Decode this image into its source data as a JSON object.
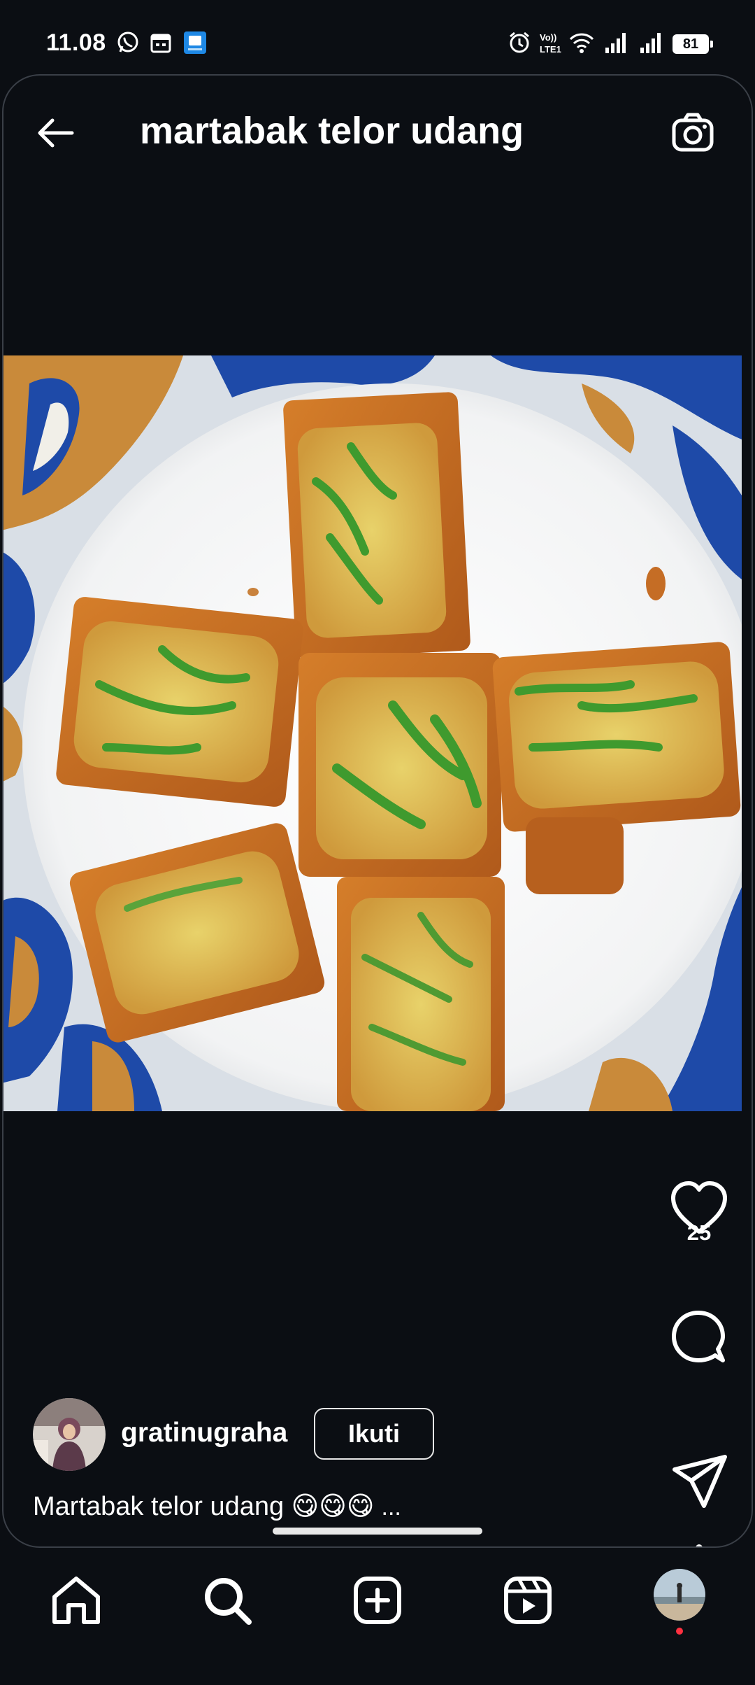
{
  "status_bar": {
    "time": "11.08",
    "battery": "81",
    "icons": [
      "whatsapp-icon",
      "calendar-icon",
      "app-store-icon",
      "alarm-icon",
      "volte-icon",
      "wifi-icon",
      "signal-icon",
      "signal-icon"
    ]
  },
  "header": {
    "title": "martabak telor udang",
    "back_icon": "arrow-left-icon",
    "camera_icon": "camera-icon"
  },
  "post": {
    "image_alt": "martabak telor udang on a white plate",
    "like_count": "25",
    "author": {
      "username": "gratinugraha",
      "follow_label": "Ikuti"
    },
    "caption": "Martabak telor udang 😋😋😋",
    "caption_more": "..."
  },
  "actions": [
    "heart-icon",
    "comment-icon",
    "share-icon",
    "more-vertical-icon"
  ],
  "bottom_nav": [
    "home-icon",
    "search-icon",
    "create-icon",
    "reels-icon",
    "profile-avatar"
  ],
  "colors": {
    "background": "#0b0e13",
    "text": "#ffffff",
    "notification_dot": "#ff3040"
  }
}
